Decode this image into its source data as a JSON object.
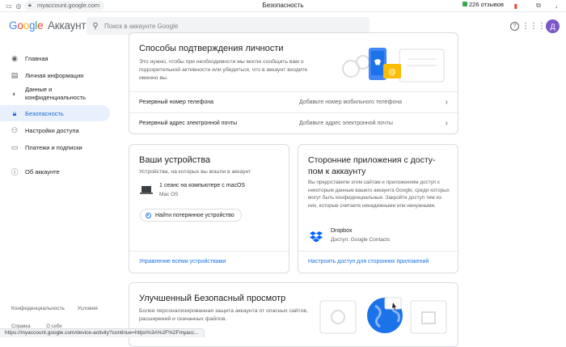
{
  "browser": {
    "url": "myaccount.google.com",
    "tab_title": "Безопасность",
    "reviews": "226 отзывов"
  },
  "header": {
    "logo_g": "G",
    "logo_o1": "o",
    "logo_o2": "o",
    "logo_g2": "g",
    "logo_l": "l",
    "logo_e": "e",
    "product": "Аккаунт",
    "search_placeholder": "Поиск в аккаунте Google",
    "avatar_letter": "Д"
  },
  "sidebar": {
    "items": [
      {
        "label": "Главная",
        "icon": "person-circle-icon"
      },
      {
        "label": "Личная информация",
        "icon": "id-card-icon"
      },
      {
        "label": "Данные и конфиденциальность",
        "icon": "toggle-icon"
      },
      {
        "label": "Безопасность",
        "icon": "lock-icon"
      },
      {
        "label": "Настройки доступа",
        "icon": "people-icon"
      },
      {
        "label": "Платежи и подписки",
        "icon": "credit-card-icon"
      },
      {
        "label": "Об аккаунте",
        "icon": "info-icon"
      }
    ],
    "footer_privacy": "Конфиденциальность",
    "footer_terms": "Условия",
    "footer_help": "Справка",
    "footer_about": "О себе"
  },
  "status_bar": "https://myaccount.google.com/device-activity?continue=https%3A%2F%2Fmyacc...",
  "verification": {
    "title": "Способы подтверждения личности",
    "description": "Это нужно, чтобы при необходимости мы могли сообщить вам о подозрительной активности или убедиться, что в аккаунт входите именно вы.",
    "rows": [
      {
        "label": "Резервный номер телефона",
        "value": "Добавьте номер мобильного телефона"
      },
      {
        "label": "Резервный адрес электронной почты",
        "value": "Добавьте адрес электронной почты"
      }
    ]
  },
  "devices": {
    "title": "Ваши устройства",
    "description": "Устройства, на которых вы вошли в аккаунт",
    "session": "1 сеанс на компьютере с macOS",
    "os": "Mac OS",
    "find_button": "Найти потерянное устройство",
    "manage_link": "Управление всеми устройствами"
  },
  "third_party": {
    "title_line1": "Сторонние приложения с досту-",
    "title_line2": "пом к аккаунту",
    "description": "Вы предоставили этим сайтам и приложениям доступ к некоторым данным вашего аккаунта Google, среди которых могут быть конфиденциальные. Закройте доступ тем из них, которые считаете ненадежными или ненужными.",
    "app_name": "Dropbox",
    "app_access": "Доступ: Google Contacts",
    "configure_link": "Настроить доступ для сторонних приложений"
  },
  "safe_browsing": {
    "title": "Улучшенный Безопасный просмотр",
    "description": "Более персонализированная защита аккаунта от опасных сайтов, расширений и скачанных файлов."
  },
  "colors": {
    "accent": "#1a73e8",
    "active_bg": "#e8f0fe",
    "avatar": "#7b57c8"
  }
}
